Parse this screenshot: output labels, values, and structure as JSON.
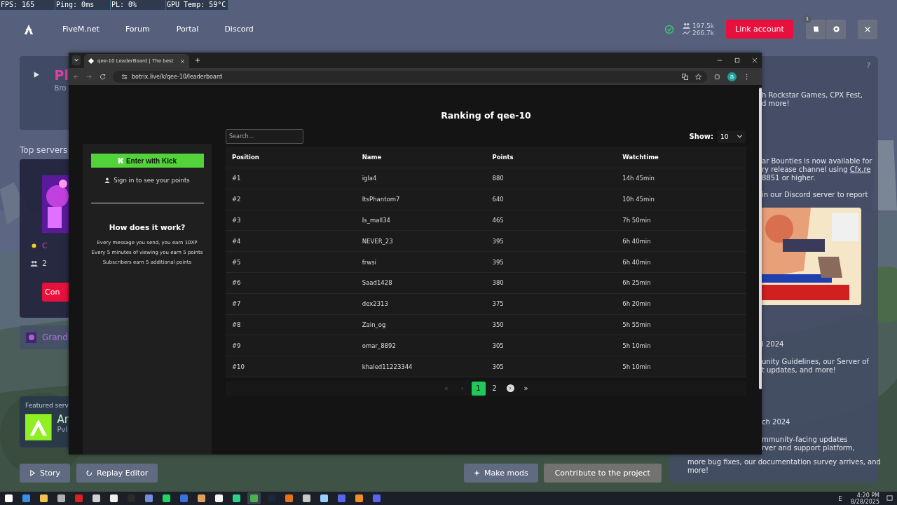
{
  "overlay_stats": [
    "FPS: 165",
    "Ping: 0ms",
    "PL: 0%",
    "GPU Temp: 59°C"
  ],
  "fivem": {
    "nav": [
      "FiveM.net",
      "Forum",
      "Portal",
      "Discord"
    ],
    "players": "197.5k",
    "trend": "266.7k",
    "link_button": "Link account",
    "notification_count": "1",
    "left": {
      "hero_title": "Pl",
      "hero_sub": "Bro",
      "section": "Top servers",
      "server_initial": "C",
      "server_players": "2",
      "connect": "Con",
      "server_link": "Grand",
      "featured_label": "Featured serv",
      "featured_title": "Ar",
      "featured_sub": "Pvl"
    },
    "help": "?",
    "news": [
      {
        "paragraphs": [
          [
            "h Rockstar Games, CPX Fest,",
            "d more!"
          ]
        ]
      },
      {
        "paragraphs": [
          [
            "ar Bounties is now available for",
            {
              "text": "ry release channel using ",
              "link": "Cfx.re"
            },
            "8851 or higher."
          ],
          [
            "in our Discord server to report"
          ]
        ],
        "picture": true
      },
      {
        "date": "l 2024",
        "paragraphs": [
          [
            "unity Guidelines, our Server of",
            "t updates, and more!"
          ]
        ]
      },
      {
        "date": "ch 2024",
        "paragraphs": [
          [
            "mmunity-facing updates",
            "rver and support platform,"
          ]
        ]
      }
    ],
    "news_tail": [
      "more bug fixes, our documentation survey arrives, and",
      "more!"
    ],
    "bottom_left": [
      {
        "label": "Story",
        "kind": "play"
      },
      {
        "label": "Replay Editor",
        "kind": "replay"
      }
    ],
    "bottom_right": [
      {
        "label": "Make mods",
        "kind": "mods"
      },
      {
        "label": "Contribute to the project",
        "kind": "plain"
      }
    ]
  },
  "browser": {
    "tab_title": "qee-10 LeaderBoard | The best",
    "url": "botrix.live/k/qee-10/leaderboard",
    "profile_initial": "a",
    "page": {
      "title": "Ranking of qee-10",
      "search_placeholder": "Search...",
      "show_label": "Show:",
      "show_value": "10",
      "login": {
        "kick_button": "Enter with Kick",
        "sign_in": "Sign in to see your points",
        "how_title": "How does it work?",
        "how_lines": [
          "Every message you send, you earn 10XP",
          "Every 5 minutes of viewing you earn 5 points",
          "Subscribers earn 5 additional points"
        ]
      },
      "table": {
        "columns": [
          "Position",
          "Name",
          "Points",
          "Watchtime"
        ],
        "rows": [
          {
            "position": "#1",
            "name": "igla4",
            "points": "880",
            "watchtime": "14h 45min"
          },
          {
            "position": "#2",
            "name": "ItsPhantom7",
            "points": "640",
            "watchtime": "10h 45min"
          },
          {
            "position": "#3",
            "name": "Is_mall34",
            "points": "465",
            "watchtime": "7h 50min"
          },
          {
            "position": "#4",
            "name": "NEVER_23",
            "points": "395",
            "watchtime": "6h 40min"
          },
          {
            "position": "#5",
            "name": "frwsi",
            "points": "395",
            "watchtime": "6h 40min"
          },
          {
            "position": "#6",
            "name": "Saad1428",
            "points": "380",
            "watchtime": "6h 25min"
          },
          {
            "position": "#7",
            "name": "dex2313",
            "points": "375",
            "watchtime": "6h 20min"
          },
          {
            "position": "#8",
            "name": "Zain_og",
            "points": "350",
            "watchtime": "5h 55min"
          },
          {
            "position": "#9",
            "name": "omar_8892",
            "points": "305",
            "watchtime": "5h 10min"
          },
          {
            "position": "#10",
            "name": "khaled11223344",
            "points": "305",
            "watchtime": "5h 10min"
          }
        ]
      },
      "pagination": [
        {
          "label": "«",
          "selected": false,
          "disabled": true
        },
        {
          "label": "‹",
          "selected": false,
          "disabled": true
        },
        {
          "label": "1",
          "selected": true,
          "disabled": false
        },
        {
          "label": "2",
          "selected": false,
          "disabled": false
        },
        {
          "label": "›",
          "selected": false,
          "disabled": false
        },
        {
          "label": "»",
          "selected": false,
          "disabled": false
        }
      ]
    }
  },
  "taskbar": {
    "apps": [
      {
        "color": "#ffffff",
        "selected": false
      },
      {
        "color": "#3a8ee6",
        "selected": false
      },
      {
        "color": "#f2c14e",
        "selected": false
      },
      {
        "color": "#b0b0b0",
        "selected": false
      },
      {
        "color": "#e02020",
        "selected": false
      },
      {
        "color": "#d0d0d0",
        "selected": false
      },
      {
        "color": "#f0f0f0",
        "selected": false
      },
      {
        "color": "#2b2b2b",
        "selected": false
      },
      {
        "color": "#6f8fdc",
        "selected": false
      },
      {
        "color": "#1ed760",
        "selected": false
      },
      {
        "color": "#3d6fe0",
        "selected": false
      },
      {
        "color": "#e0a060",
        "selected": false
      },
      {
        "color": "#f5f5f5",
        "selected": false
      },
      {
        "color": "#2fd18a",
        "selected": false
      },
      {
        "color": "#4caf50",
        "selected": true
      },
      {
        "color": "#1b2838",
        "selected": false
      },
      {
        "color": "#e8721c",
        "selected": false
      },
      {
        "color": "#c8c8c8",
        "selected": false
      },
      {
        "color": "#9ad0ff",
        "selected": false
      },
      {
        "color": "#5865f2",
        "selected": false
      },
      {
        "color": "#f28c28",
        "selected": false
      },
      {
        "color": "#5865f2",
        "selected": false
      }
    ],
    "tray_label": "E",
    "time": "4:20 PM",
    "date": "8/28/2025"
  }
}
